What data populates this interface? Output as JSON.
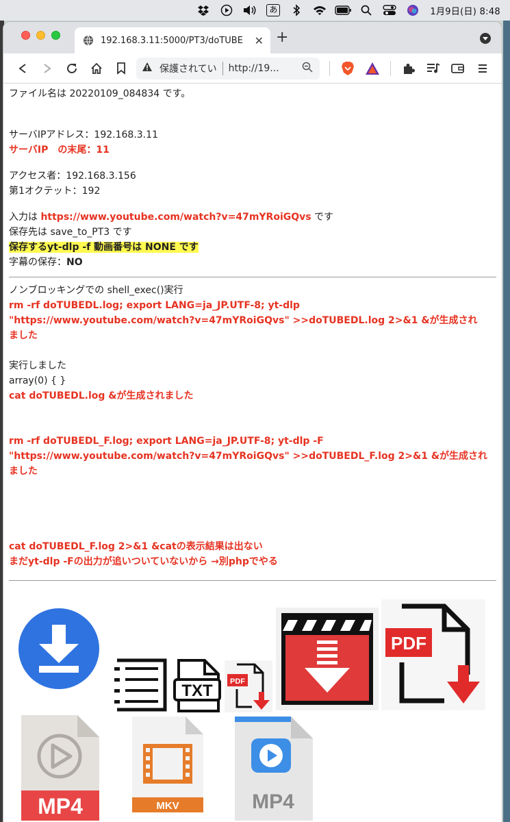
{
  "menubar": {
    "clock": "1月9日(日)  8:48",
    "input_icon": "あ"
  },
  "tab": {
    "title": "192.168.3.11:5000/PT3/doTUBE"
  },
  "address_bar": {
    "security": "保護されてい",
    "url": "http://19..."
  },
  "page": {
    "filename_line": "ファイル名は 20220109_084834 です。",
    "server_ip_line": "サーバIPアドレス：192.168.3.11",
    "server_ip_tail": "サーバIP　の末尾：11",
    "accessor_line": "アクセス者：192.168.3.156",
    "octet_line": "第1オクテット：192",
    "input_prefix": "入力は ",
    "input_url": "https://www.youtube.com/watch?v=47mYRoiGQvs",
    "input_suffix": " です",
    "save_dest_line": "保存先は save_to_PT3 です",
    "format_line": "保存するyt-dlp -f 動画番号は NONE です",
    "subtitle_label": "字幕の保存：",
    "subtitle_value": "NO",
    "nonblocking_line": "ノンブロッキングでの shell_exec()実行",
    "cmd1_line1": "rm -rf doTUBEDL.log; export LANG=ja_JP.UTF-8; yt-dlp",
    "cmd1_line2": "\"https://www.youtube.com/watch?v=47mYRoiGQvs\" >>doTUBEDL.log 2>&1 &が生成され",
    "cmd1_line3": "ました",
    "executed_line": "実行しました",
    "array_line": "array(0) { }",
    "cat1_line": "cat doTUBEDL.log &が生成されました",
    "cmd2_line1": "rm -rf doTUBEDL_F.log; export LANG=ja_JP.UTF-8; yt-dlp -F",
    "cmd2_line2": "\"https://www.youtube.com/watch?v=47mYRoiGQvs\" >>doTUBEDL_F.log 2>&1 &が生成され",
    "cmd2_line3": "ました",
    "cat2_line1": "cat doTUBEDL_F.log 2>&1 &catの表示結果は出ない",
    "cat2_line2": "まだyt-dlp -Fの出力が追いついていないから →別phpでやる"
  },
  "icons": {
    "txt_label": "TXT",
    "pdf_small_label": "PDF",
    "pdf_large_label": "PDF",
    "mp4_red_label": "MP4",
    "mkv_label": "MKV",
    "mp4_blue_label": "MP4"
  },
  "colors": {
    "accent_red": "#e63322",
    "highlight": "#fffa50",
    "download_blue": "#2f73e0"
  }
}
